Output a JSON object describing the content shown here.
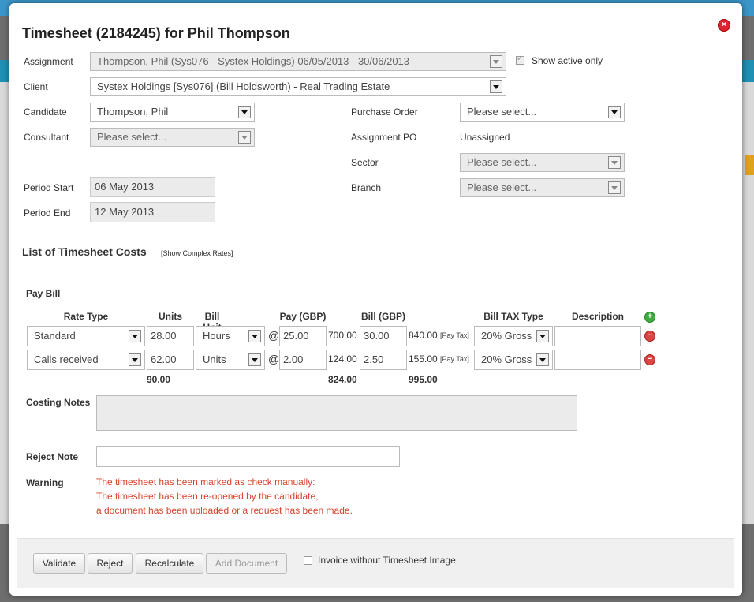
{
  "dialog": {
    "title": "Timesheet (2184245) for Phil Thompson"
  },
  "form": {
    "assignment_label": "Assignment",
    "assignment_value": "Thompson, Phil (Sys076 - Systex Holdings) 06/05/2013 - 30/06/2013",
    "show_active_only": "Show active only",
    "client_label": "Client",
    "client_value": "Systex Holdings [Sys076] (Bill Holdsworth) - Real Trading Estate",
    "candidate_label": "Candidate",
    "candidate_value": "Thompson, Phil",
    "consultant_label": "Consultant",
    "consultant_value": "Please select...",
    "purchase_order_label": "Purchase Order",
    "purchase_order_value": "Please select...",
    "assignment_po_label": "Assignment PO",
    "assignment_po_value": "Unassigned",
    "sector_label": "Sector",
    "sector_value": "Please select...",
    "branch_label": "Branch",
    "branch_value": "Please select...",
    "period_start_label": "Period Start",
    "period_start_value": "06 May 2013",
    "period_end_label": "Period End",
    "period_end_value": "12 May 2013"
  },
  "costs": {
    "title": "List of Timesheet Costs",
    "complex_rates_link": "[Show Complex Rates]",
    "pay_bill_label": "Pay Bill",
    "headers": {
      "rate_type": "Rate Type",
      "units": "Units",
      "bill_unit": "Bill Unit",
      "pay": "Pay (GBP)",
      "bill": "Bill (GBP)",
      "bill_tax_type": "Bill TAX Type",
      "description": "Description"
    },
    "rows": [
      {
        "rate_type": "Standard",
        "units": "28.00",
        "bill_unit": "Hours",
        "at": "@",
        "pay": "25.00",
        "pay_total": "700.00",
        "bill": "30.00",
        "bill_total": "840.00",
        "pay_tax": "[Pay Tax]",
        "tax_type": "20% Gross",
        "description": ""
      },
      {
        "rate_type": "Calls received",
        "units": "62.00",
        "bill_unit": "Units",
        "at": "@",
        "pay": "2.00",
        "pay_total": "124.00",
        "bill": "2.50",
        "bill_total": "155.00",
        "pay_tax": "[Pay Tax]",
        "tax_type": "20% Gross",
        "description": ""
      }
    ],
    "totals": {
      "units": "90.00",
      "pay": "824.00",
      "bill": "995.00"
    }
  },
  "notes": {
    "costing_notes_label": "Costing Notes",
    "reject_note_label": "Reject Note",
    "warning_label": "Warning",
    "warning_lines": [
      "The timesheet has been marked as check manually:",
      "The timesheet has been re-opened by the candidate,",
      "a document has been uploaded or a request has been made."
    ]
  },
  "footer": {
    "validate": "Validate",
    "reject": "Reject",
    "recalculate": "Recalculate",
    "add_document": "Add Document",
    "invoice_without_image": "Invoice without Timesheet Image."
  },
  "icons": {
    "close": "close-icon",
    "add_row": "add-icon",
    "remove_row": "remove-icon",
    "dropdown": "chevron-down-icon"
  },
  "colors": {
    "warning": "#d9432b",
    "close": "#dd2233",
    "add": "#44aa44",
    "remove": "#dd4444"
  }
}
